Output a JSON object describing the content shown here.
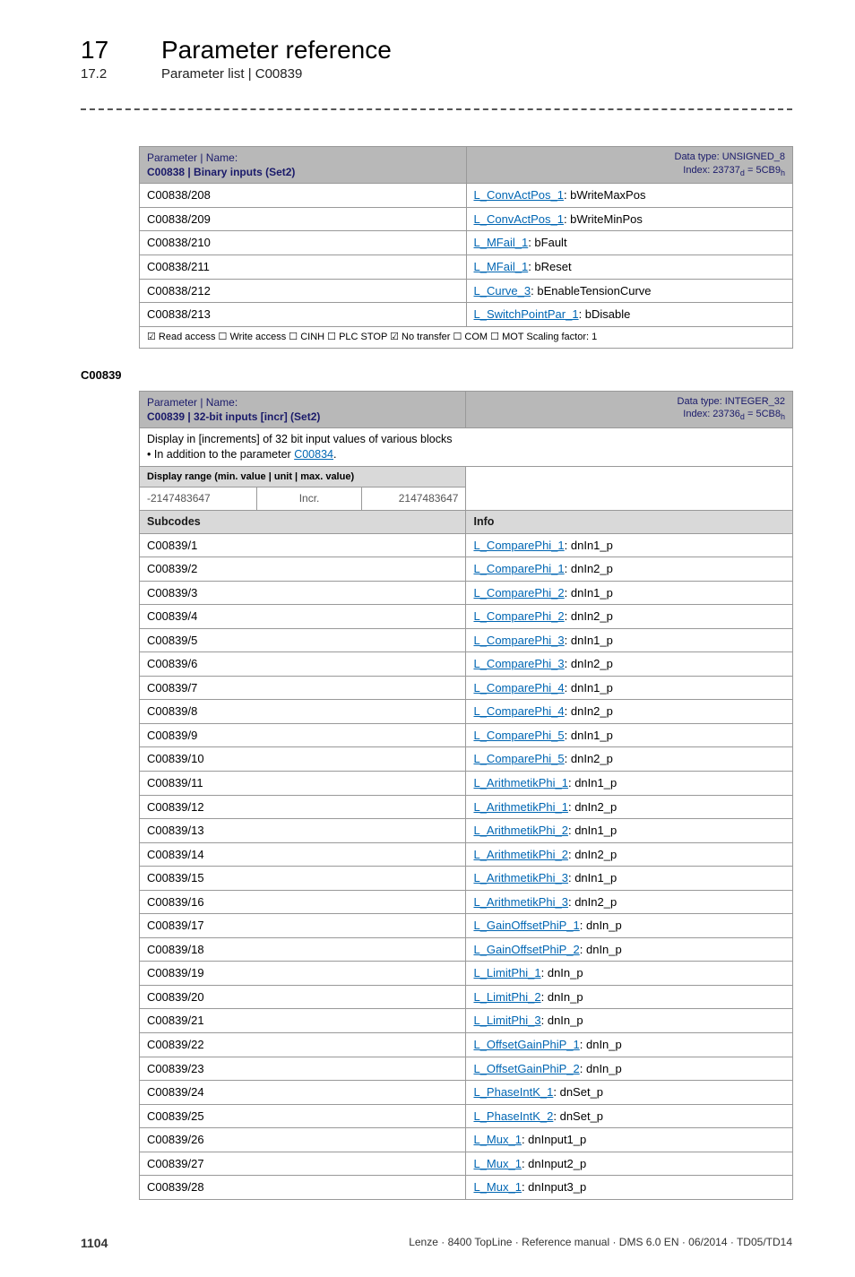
{
  "header": {
    "chapter_num": "17",
    "chapter_title": "Parameter reference",
    "section_num": "17.2",
    "section_title": "Parameter list | C00839"
  },
  "table1": {
    "param_label": "Parameter | Name:",
    "param_name": "C00838 | Binary inputs (Set2)",
    "data_type": "Data type: UNSIGNED_8",
    "index": "Index: 23737",
    "index_d": "d",
    "index_eq": " = 5CB9",
    "index_h": "h",
    "rows": [
      {
        "sub": "C00838/208",
        "link": "L_ConvActPos_1",
        "suffix": ": bWriteMaxPos"
      },
      {
        "sub": "C00838/209",
        "link": "L_ConvActPos_1",
        "suffix": ": bWriteMinPos"
      },
      {
        "sub": "C00838/210",
        "link": "L_MFail_1",
        "suffix": ": bFault"
      },
      {
        "sub": "C00838/211",
        "link": "L_MFail_1",
        "suffix": ": bReset"
      },
      {
        "sub": "C00838/212",
        "link": "L_Curve_3",
        "suffix": ": bEnableTensionCurve"
      },
      {
        "sub": "C00838/213",
        "link": "L_SwitchPointPar_1",
        "suffix": ": bDisable"
      }
    ],
    "footer": "☑ Read access   ☐ Write access   ☐ CINH   ☐ PLC STOP   ☑ No transfer   ☐ COM   ☐ MOT     Scaling factor: 1"
  },
  "anchor": "C00839",
  "table2": {
    "param_label": "Parameter | Name:",
    "param_name": "C00839 | 32-bit inputs [incr] (Set2)",
    "data_type": "Data type: INTEGER_32",
    "index": "Index: 23736",
    "index_d": "d",
    "index_eq": " = 5CB8",
    "index_h": "h",
    "desc_line1": "Display in [increments] of 32 bit input values of various blocks",
    "desc_line2_prefix": "• In addition to the parameter ",
    "desc_link": "C00834",
    "desc_suffix": ".",
    "range_label": "Display range (min. value | unit | max. value)",
    "range_min": "-2147483647",
    "range_unit": "Incr.",
    "range_max": "2147483647",
    "subcodes_label": "Subcodes",
    "info_label": "Info",
    "rows": [
      {
        "sub": "C00839/1",
        "link": "L_ComparePhi_1",
        "suffix": ": dnIn1_p"
      },
      {
        "sub": "C00839/2",
        "link": "L_ComparePhi_1",
        "suffix": ": dnIn2_p"
      },
      {
        "sub": "C00839/3",
        "link": "L_ComparePhi_2",
        "suffix": ": dnIn1_p"
      },
      {
        "sub": "C00839/4",
        "link": "L_ComparePhi_2",
        "suffix": ": dnIn2_p"
      },
      {
        "sub": "C00839/5",
        "link": "L_ComparePhi_3",
        "suffix": ": dnIn1_p"
      },
      {
        "sub": "C00839/6",
        "link": "L_ComparePhi_3",
        "suffix": ": dnIn2_p"
      },
      {
        "sub": "C00839/7",
        "link": "L_ComparePhi_4",
        "suffix": ": dnIn1_p"
      },
      {
        "sub": "C00839/8",
        "link": "L_ComparePhi_4",
        "suffix": ": dnIn2_p"
      },
      {
        "sub": "C00839/9",
        "link": "L_ComparePhi_5",
        "suffix": ": dnIn1_p"
      },
      {
        "sub": "C00839/10",
        "link": "L_ComparePhi_5",
        "suffix": ": dnIn2_p"
      },
      {
        "sub": "C00839/11",
        "link": "L_ArithmetikPhi_1",
        "suffix": ": dnIn1_p"
      },
      {
        "sub": "C00839/12",
        "link": "L_ArithmetikPhi_1",
        "suffix": ": dnIn2_p"
      },
      {
        "sub": "C00839/13",
        "link": "L_ArithmetikPhi_2",
        "suffix": ": dnIn1_p"
      },
      {
        "sub": "C00839/14",
        "link": "L_ArithmetikPhi_2",
        "suffix": ": dnIn2_p"
      },
      {
        "sub": "C00839/15",
        "link": "L_ArithmetikPhi_3",
        "suffix": ": dnIn1_p"
      },
      {
        "sub": "C00839/16",
        "link": "L_ArithmetikPhi_3",
        "suffix": ": dnIn2_p"
      },
      {
        "sub": "C00839/17",
        "link": "L_GainOffsetPhiP_1",
        "suffix": ": dnIn_p"
      },
      {
        "sub": "C00839/18",
        "link": "L_GainOffsetPhiP_2",
        "suffix": ": dnIn_p"
      },
      {
        "sub": "C00839/19",
        "link": "L_LimitPhi_1",
        "suffix": ": dnIn_p"
      },
      {
        "sub": "C00839/20",
        "link": "L_LimitPhi_2",
        "suffix": ": dnIn_p"
      },
      {
        "sub": "C00839/21",
        "link": "L_LimitPhi_3",
        "suffix": ": dnIn_p"
      },
      {
        "sub": "C00839/22",
        "link": "L_OffsetGainPhiP_1",
        "suffix": ": dnIn_p"
      },
      {
        "sub": "C00839/23",
        "link": "L_OffsetGainPhiP_2",
        "suffix": ": dnIn_p"
      },
      {
        "sub": "C00839/24",
        "link": "L_PhaseIntK_1",
        "suffix": ": dnSet_p"
      },
      {
        "sub": "C00839/25",
        "link": "L_PhaseIntK_2",
        "suffix": ": dnSet_p"
      },
      {
        "sub": "C00839/26",
        "link": "L_Mux_1",
        "suffix": ": dnInput1_p"
      },
      {
        "sub": "C00839/27",
        "link": "L_Mux_1",
        "suffix": ": dnInput2_p"
      },
      {
        "sub": "C00839/28",
        "link": "L_Mux_1",
        "suffix": ": dnInput3_p"
      }
    ]
  },
  "footer": {
    "page": "1104",
    "doc": "Lenze · 8400 TopLine · Reference manual · DMS 6.0 EN · 06/2014 · TD05/TD14"
  }
}
